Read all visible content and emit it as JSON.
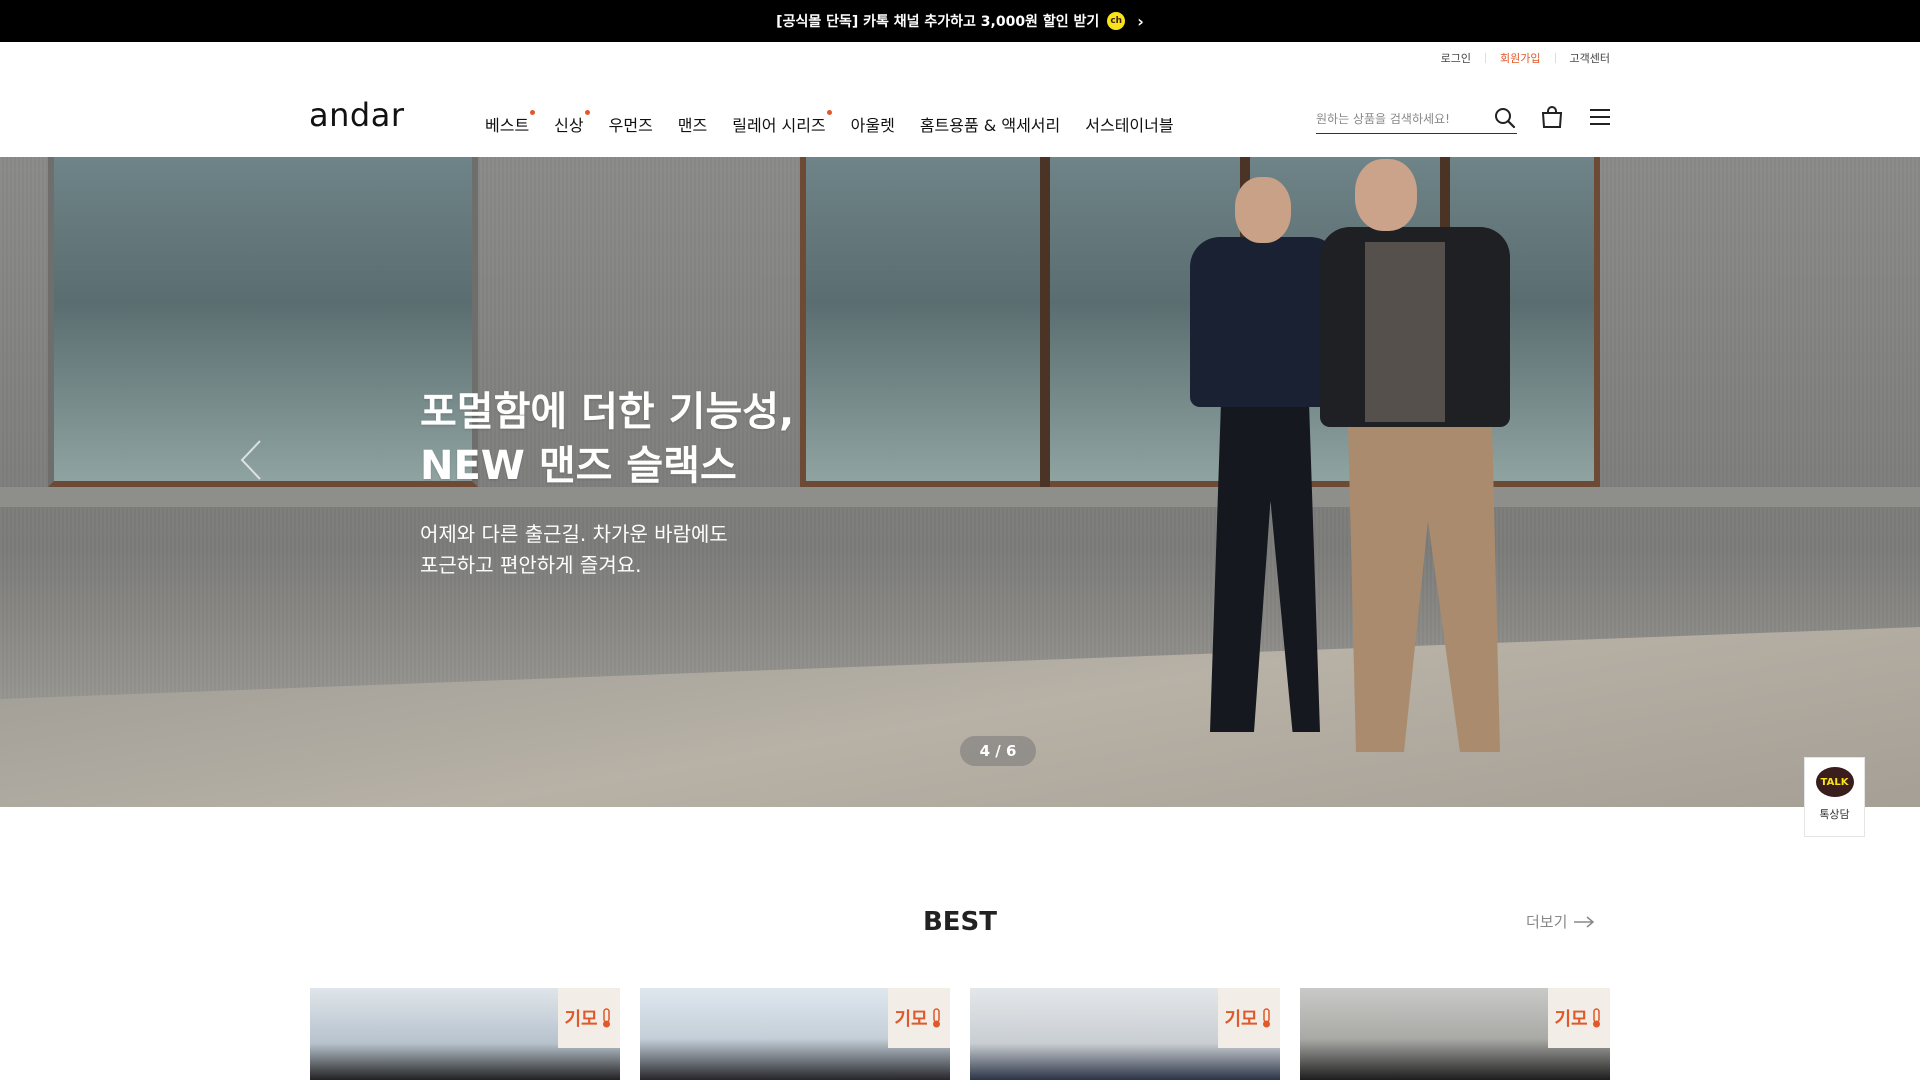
{
  "promo": {
    "text": "[공식몰 단독] 카톡 채널 추가하고 3,000원 할인 받기",
    "channel_badge": "ch"
  },
  "util_links": [
    "로그인",
    "회원가입",
    "고객센터"
  ],
  "logo": "andar",
  "nav": [
    {
      "label": "베스트",
      "dot": true
    },
    {
      "label": "신상",
      "dot": true
    },
    {
      "label": "우먼즈",
      "dot": false
    },
    {
      "label": "맨즈",
      "dot": false
    },
    {
      "label": "릴레어 시리즈",
      "dot": true
    },
    {
      "label": "아울렛",
      "dot": false
    },
    {
      "label": "홈트용품 & 액세서리",
      "dot": false
    },
    {
      "label": "서스테이너블",
      "dot": false
    }
  ],
  "search": {
    "placeholder": "원하는 상품을 검색하세요!"
  },
  "hero": {
    "title_line1": "포멀함에 더한 기능성,",
    "title_line2": "NEW 맨즈 슬랙스",
    "sub_line1": "어제와 다른 출근길. 차가운 바람에도",
    "sub_line2": "포근하고 편안하게 즐겨요.",
    "pager": "4 / 6"
  },
  "talk": {
    "bubble": "TALK",
    "label": "톡상담"
  },
  "best": {
    "title": "BEST",
    "more": "더보기",
    "cards": [
      {
        "badge": "기모"
      },
      {
        "badge": "기모"
      },
      {
        "badge": "기모"
      },
      {
        "badge": "기모"
      }
    ]
  },
  "colors": {
    "accent": "#e0592a",
    "kakao": "#f7e317"
  },
  "icons": [
    "search-icon",
    "shopping-bag-icon",
    "hamburger-menu-icon",
    "chevron-left-icon",
    "arrow-right-icon",
    "thermometer-icon"
  ]
}
